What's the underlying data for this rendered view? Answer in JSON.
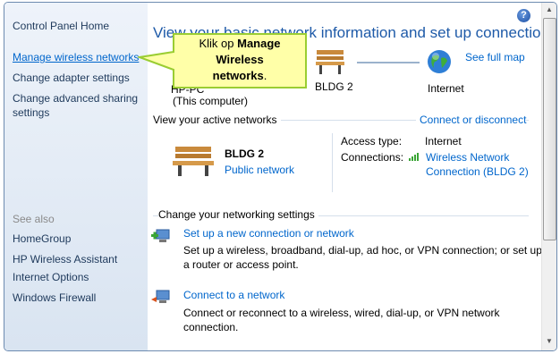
{
  "sidebar": {
    "home": "Control Panel Home",
    "items": [
      "Manage wireless networks",
      "Change adapter settings",
      "Change advanced sharing",
      "settings"
    ],
    "see_also_heading": "See also",
    "see_also": [
      "HomeGroup",
      "HP Wireless Assistant",
      "Internet Options",
      "Windows Firewall"
    ]
  },
  "main": {
    "title": "View your basic network information and set up connections",
    "see_full_map": "See full map",
    "map": {
      "computer_label_1": "HP-PC",
      "computer_label_2": "(This computer)",
      "network_label": "BLDG 2",
      "internet_label": "Internet"
    },
    "active_heading": "View your active networks",
    "connect_disconnect": "Connect or disconnect",
    "network": {
      "name": "BLDG 2",
      "type": "Public network",
      "access_type_label": "Access type:",
      "access_type_value": "Internet",
      "connections_label": "Connections:",
      "connections_value_1": "Wireless Network",
      "connections_value_2": "Connection (BLDG 2)"
    },
    "settings_heading": "Change your networking settings",
    "tasks": [
      {
        "title": "Set up a new connection or network",
        "desc_1": "Set up a wireless, broadband, dial-up, ad hoc, or VPN connection; or set up",
        "desc_2": "a router or access point."
      },
      {
        "title": "Connect to a network",
        "desc_1": "Connect or reconnect to a wireless, wired, dial-up, or VPN network",
        "desc_2": "connection."
      }
    ]
  },
  "help": "?",
  "callout": {
    "prefix": "Klik op ",
    "bold_1": "Manage",
    "bold_2": "Wireless",
    "bold_3": "networks",
    "suffix": "."
  },
  "colors": {
    "link": "#0066cc",
    "title": "#1e5aa8",
    "callout_fill": "#ffffa8",
    "callout_border": "#9acd32"
  }
}
